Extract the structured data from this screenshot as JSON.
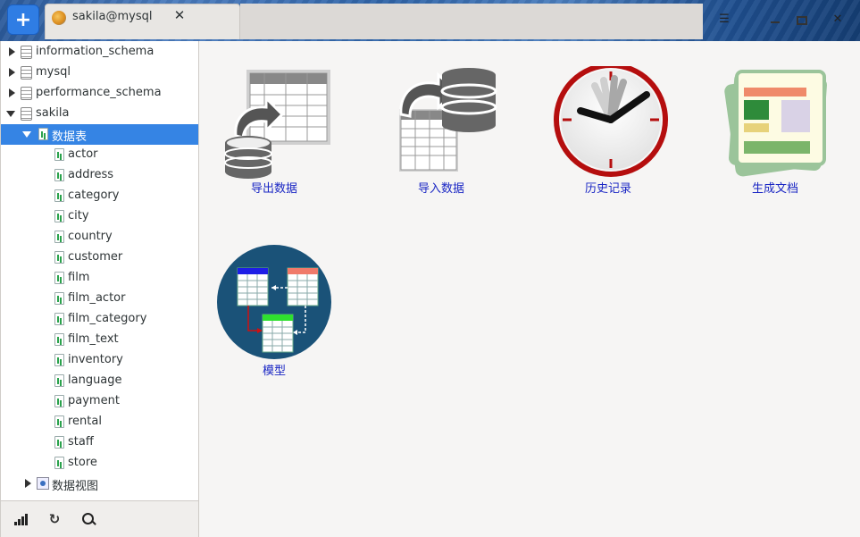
{
  "window": {
    "add_button": "+",
    "tab_title": "sakila@mysql",
    "tab_close": "✕",
    "menu_icon": "☰",
    "close_icon": "✕"
  },
  "sidebar": {
    "databases": [
      {
        "label": "information_schema",
        "expanded": false
      },
      {
        "label": "mysql",
        "expanded": false
      },
      {
        "label": "performance_schema",
        "expanded": false
      },
      {
        "label": "sakila",
        "expanded": true
      }
    ],
    "tables_folder": "数据表",
    "tables": [
      "actor",
      "address",
      "category",
      "city",
      "country",
      "customer",
      "film",
      "film_actor",
      "film_category",
      "film_text",
      "inventory",
      "language",
      "payment",
      "rental",
      "staff",
      "store"
    ],
    "views_folder": "数据视图"
  },
  "footer": {
    "refresh_icon": "↻"
  },
  "tools": [
    {
      "label": "导出数据",
      "icon": "export-data-icon"
    },
    {
      "label": "导入数据",
      "icon": "import-data-icon"
    },
    {
      "label": "历史记录",
      "icon": "history-clock-icon"
    },
    {
      "label": "生成文档",
      "icon": "generate-doc-icon"
    },
    {
      "label": "模型",
      "icon": "model-diagram-icon"
    }
  ],
  "colors": {
    "selection": "#3584e4",
    "link_text": "#1a26c4",
    "add_button": "#2f7de4"
  }
}
